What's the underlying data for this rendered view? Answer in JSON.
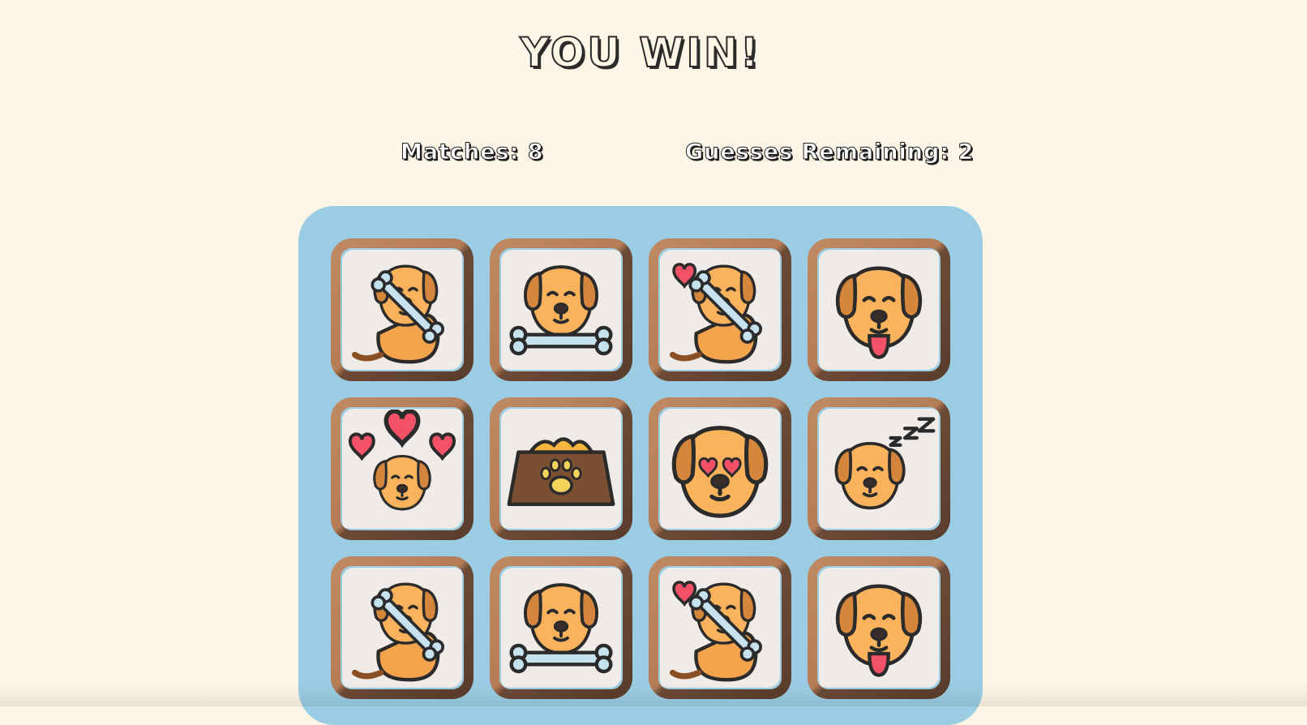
{
  "title": "YOU WIN!",
  "stats": {
    "matches": "Matches: 8",
    "guesses": "Guesses Remaining: 2"
  },
  "colors": {
    "background": "#fdf6e7",
    "board": "#9acde3",
    "card_frame": "#b57d57",
    "card_face": "#efebe9",
    "dog": "#fbb25c",
    "ear": "#d4873c",
    "heart": "#f25168",
    "bone": "#c6e2ef"
  },
  "cards": [
    {
      "icon": "sitting-dog-with-bone-icon"
    },
    {
      "icon": "dog-holding-bone-icon"
    },
    {
      "icon": "sitting-dog-with-bone-and-heart-icon"
    },
    {
      "icon": "dog-tongue-out-icon"
    },
    {
      "icon": "dog-with-hearts-icon"
    },
    {
      "icon": "food-bowl-icon"
    },
    {
      "icon": "dog-heart-eyes-icon"
    },
    {
      "icon": "sleeping-dog-icon"
    },
    {
      "icon": "sitting-dog-with-bone-icon"
    },
    {
      "icon": "dog-holding-bone-icon"
    },
    {
      "icon": "sitting-dog-with-bone-and-heart-icon"
    },
    {
      "icon": "dog-tongue-out-icon"
    }
  ]
}
